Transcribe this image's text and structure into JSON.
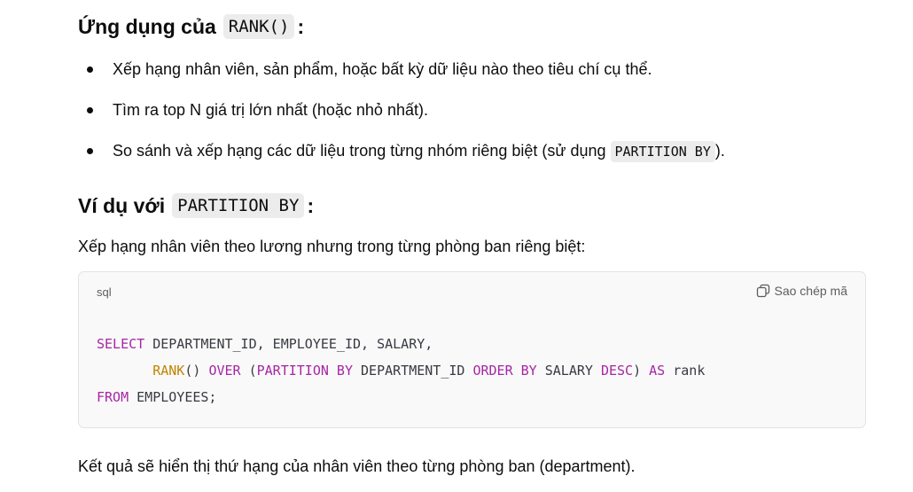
{
  "section1": {
    "heading_text": "Ứng dụng của",
    "heading_code": "RANK()",
    "heading_suffix": ":",
    "bullets": [
      "Xếp hạng nhân viên, sản phẩm, hoặc bất kỳ dữ liệu nào theo tiêu chí cụ thể.",
      "Tìm ra top N giá trị lớn nhất (hoặc nhỏ nhất).",
      {
        "before": "So sánh và xếp hạng các dữ liệu trong từng nhóm riêng biệt (sử dụng ",
        "code": "PARTITION BY",
        "after": ")."
      }
    ]
  },
  "section2": {
    "heading_text": "Ví dụ với",
    "heading_code": "PARTITION BY",
    "heading_suffix": ":",
    "intro": "Xếp hạng nhân viên theo lương nhưng trong từng phòng ban riêng biệt:",
    "code_block": {
      "language": "sql",
      "copy_label": "Sao chép mã",
      "copy_icon": "copy-icon",
      "tokens": {
        "line1_kw_select": "SELECT",
        "line1_rest": " DEPARTMENT_ID, EMPLOYEE_ID, SALARY,",
        "line2_indent": "       ",
        "line2_fn_rank": "RANK",
        "line2_paren": "() ",
        "line2_kw_over": "OVER",
        "line2_open": " (",
        "line2_kw_partition": "PARTITION BY",
        "line2_dept": " DEPARTMENT_ID ",
        "line2_kw_order": "ORDER BY",
        "line2_salary": " SALARY ",
        "line2_kw_desc": "DESC",
        "line2_close": ") ",
        "line2_kw_as": "AS",
        "line2_rank": " rank",
        "line3_kw_from": "FROM",
        "line3_rest": " EMPLOYEES;"
      }
    },
    "outro": "Kết quả sẽ hiển thị thứ hạng của nhân viên theo từng phòng ban (department)."
  },
  "colors": {
    "keyword": "#a626a4",
    "function": "#c18401",
    "text": "#0d0d0d",
    "code_bg": "#f9f9f9",
    "inline_code_bg": "#ececec"
  }
}
